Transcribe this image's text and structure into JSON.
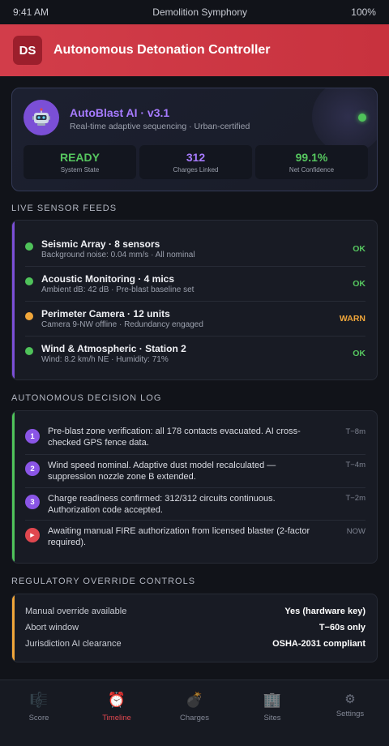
{
  "status_bar": {
    "time": "9:41 AM",
    "title": "Demolition Symphony",
    "battery": "100%"
  },
  "header": {
    "logo": "DS",
    "title": "Autonomous Detonation Controller"
  },
  "ai_card": {
    "name": "AutoBlast AI · v3.1",
    "subtitle": "Real-time adaptive sequencing · Urban-certified",
    "avatar_icon": "robot-icon",
    "stats": [
      {
        "value": "READY",
        "label": "System State",
        "color": "#56c65f"
      },
      {
        "value": "312",
        "label": "Charges Linked",
        "color": "#a77bff"
      },
      {
        "value": "99.1%",
        "label": "Net Confidence",
        "color": "#56c65f"
      }
    ]
  },
  "sensors": {
    "title": "LIVE SENSOR FEEDS",
    "accent": "#7b4fd6",
    "items": [
      {
        "name": "Seismic Array · 8 sensors",
        "detail": "Background noise: 0.04 mm/s · All nominal",
        "status": "OK",
        "color": "#4fc25a"
      },
      {
        "name": "Acoustic Monitoring · 4 mics",
        "detail": "Ambient dB: 42 dB · Pre-blast baseline set",
        "status": "OK",
        "color": "#4fc25a"
      },
      {
        "name": "Perimeter Camera · 12 units",
        "detail": "Camera 9-NW offline · Redundancy engaged",
        "status": "WARN",
        "color": "#f0a63a"
      },
      {
        "name": "Wind & Atmospheric · Station 2",
        "detail": "Wind: 8.2 km/h NE · Humidity: 71%",
        "status": "OK",
        "color": "#4fc25a"
      }
    ]
  },
  "decision_log": {
    "title": "AUTONOMOUS DECISION LOG",
    "accent": "#4fc25a",
    "items": [
      {
        "badge": "1",
        "text": "Pre-blast zone verification: all 178 contacts evacuated. AI cross-checked GPS fence data.",
        "time": "T−8m",
        "color": "#8a55e6"
      },
      {
        "badge": "2",
        "text": "Wind speed nominal. Adaptive dust model recalculated — suppression nozzle zone B extended.",
        "time": "T−4m",
        "color": "#8a55e6"
      },
      {
        "badge": "3",
        "text": "Charge readiness confirmed: 312/312 circuits continuous. Authorization code accepted.",
        "time": "T−2m",
        "color": "#8a55e6"
      },
      {
        "badge": "▶",
        "text": "Awaiting manual FIRE authorization from licensed blaster (2-factor required).",
        "time": "NOW",
        "color": "#e0474f"
      }
    ]
  },
  "overrides": {
    "title": "REGULATORY OVERRIDE CONTROLS",
    "accent": "#f0a63a",
    "items": [
      {
        "label": "Manual override available",
        "value": "Yes (hardware key)"
      },
      {
        "label": "Abort window",
        "value": "T−60s only"
      },
      {
        "label": "Jurisdiction AI clearance",
        "value": "OSHA-2031 compliant"
      }
    ]
  },
  "nav": {
    "active": "Timeline",
    "items": [
      {
        "label": "Score",
        "icon": "🎼",
        "icon_name": "music-score-icon"
      },
      {
        "label": "Timeline",
        "icon": "⏰",
        "icon_name": "alarm-clock-icon"
      },
      {
        "label": "Charges",
        "icon": "💣",
        "icon_name": "bomb-icon"
      },
      {
        "label": "Sites",
        "icon": "🏢",
        "icon_name": "building-icon"
      },
      {
        "label": "Settings",
        "icon": "⚙",
        "icon_name": "gear-icon"
      }
    ]
  }
}
